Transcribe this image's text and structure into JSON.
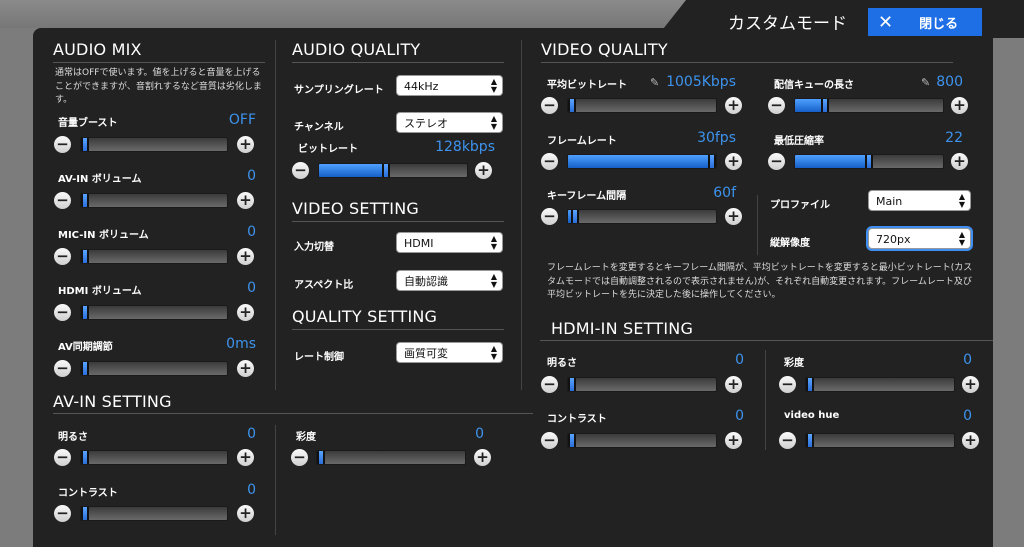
{
  "window": {
    "title": "カスタムモード",
    "close_label": "閉じる"
  },
  "audio_mix": {
    "title": "AUDIO MIX",
    "note": "通常はOFFで使います。値を上げると音量を上げることができますが、音割れするなど音質は劣化します。",
    "rows": [
      {
        "label": "音量ブースト",
        "value": "OFF"
      },
      {
        "label": "AV-IN ボリューム",
        "value": "0"
      },
      {
        "label": "MIC-IN ボリューム",
        "value": "0"
      },
      {
        "label": "HDMI ボリューム",
        "value": "0"
      },
      {
        "label": "AV同期調節",
        "value": "0ms"
      }
    ]
  },
  "audio_quality": {
    "title": "AUDIO QUALITY",
    "sampling_label": "サンプリングレート",
    "sampling_value": "44kHz",
    "channel_label": "チャンネル",
    "channel_value": "ステレオ",
    "bitrate_label": "ビットレート",
    "bitrate_value": "128kbps",
    "bitrate_level": 0.45
  },
  "video_setting": {
    "title": "VIDEO SETTING",
    "input_label": "入力切替",
    "input_value": "HDMI",
    "aspect_label": "アスペクト比",
    "aspect_value": "自動認識"
  },
  "quality_setting": {
    "title": "QUALITY SETTING",
    "rate_label": "レート制御",
    "rate_value": "画質可変"
  },
  "video_quality": {
    "title": "VIDEO QUALITY",
    "avg_bitrate_label": "平均ビットレート",
    "avg_bitrate_value": "1005Kbps",
    "avg_bitrate_level": 0.03,
    "queue_label": "配信キューの長さ",
    "queue_value": "800",
    "queue_level": 0.2,
    "framerate_label": "フレームレート",
    "framerate_value": "30fps",
    "framerate_level": 0.98,
    "compression_label": "最低圧縮率",
    "compression_value": "22",
    "compression_level": 0.5,
    "keyframe_label": "キーフレーム間隔",
    "keyframe_value": "60f",
    "keyframe_level": 0.05,
    "profile_label": "プロファイル",
    "profile_value": "Main",
    "resolution_label": "縦解像度",
    "resolution_value": "720px",
    "note": "フレームレートを変更するとキーフレーム間隔が、平均ビットレートを変更すると最小ビットレート(カスタムモードでは自動調整されるので表示されません)が、それぞれ自動変更されます。フレームレート及び平均ビットレートを先に決定した後に操作してください。"
  },
  "hdmi_in": {
    "title": "HDMI-IN SETTING",
    "brightness_label": "明るさ",
    "brightness_value": "0",
    "saturation_label": "彩度",
    "saturation_value": "0",
    "contrast_label": "コントラスト",
    "contrast_value": "0",
    "hue_label": "video hue",
    "hue_value": "0"
  },
  "av_in": {
    "title": "AV-IN SETTING",
    "brightness_label": "明るさ",
    "brightness_value": "0",
    "saturation_label": "彩度",
    "saturation_value": "0",
    "contrast_label": "コントラスト",
    "contrast_value": "0"
  },
  "controls": {
    "minus": "−",
    "plus": "+"
  }
}
